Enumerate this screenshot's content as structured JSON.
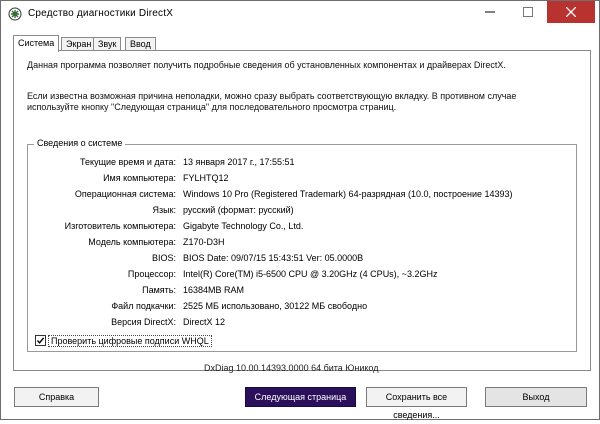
{
  "window": {
    "title": "Средство диагностики DirectX"
  },
  "tabs": [
    {
      "label": "Система",
      "active": true
    },
    {
      "label": "Экран",
      "active": false
    },
    {
      "label": "Звук",
      "active": false
    },
    {
      "label": "Ввод",
      "active": false
    }
  ],
  "intro": {
    "line1": "Данная программа позволяет получить подробные сведения об установленных компонентах и драйверах DirectX.",
    "line2": "Если известна возможная причина неполадки, можно сразу выбрать соответствующую вкладку. В противном случае используйте кнопку \"Следующая страница\" для последовательного просмотра страниц."
  },
  "system_info": {
    "group_title": "Сведения о системе",
    "rows": [
      {
        "label": "Текущие время и дата:",
        "value": "13 января 2017 г., 17:55:51"
      },
      {
        "label": "Имя компьютера:",
        "value": "FYLHTQ12"
      },
      {
        "label": "Операционная система:",
        "value": "Windows 10 Pro (Registered Trademark) 64-разрядная (10.0, построение 14393)"
      },
      {
        "label": "Язык:",
        "value": "русский (формат: русский)"
      },
      {
        "label": "Изготовитель компьютера:",
        "value": "Gigabyte Technology Co., Ltd."
      },
      {
        "label": "Модель компьютера:",
        "value": "Z170-D3H"
      },
      {
        "label": "BIOS:",
        "value": "BIOS Date: 09/07/15 15:43:51 Ver: 05.0000B"
      },
      {
        "label": "Процессор:",
        "value": "Intel(R) Core(TM) i5-6500 CPU @ 3.20GHz (4 CPUs), ~3.2GHz"
      },
      {
        "label": "Память:",
        "value": "16384MB RAM"
      },
      {
        "label": "Файл подкачки:",
        "value": "2525 МБ использовано, 30122 МБ свободно"
      },
      {
        "label": "Версия DirectX:",
        "value": "DirectX 12"
      }
    ]
  },
  "whql_checkbox": {
    "label": "Проверить цифровые подписи WHQL",
    "checked": true
  },
  "dxdiag_version": "DxDiag 10.00.14393.0000 64 бита Юникод",
  "buttons": {
    "help": "Справка",
    "next": "Следующая страница",
    "save": "Сохранить все сведения...",
    "exit": "Выход"
  },
  "colors": {
    "close_button": "#b8322f",
    "next_button": "#2a0f5a"
  }
}
